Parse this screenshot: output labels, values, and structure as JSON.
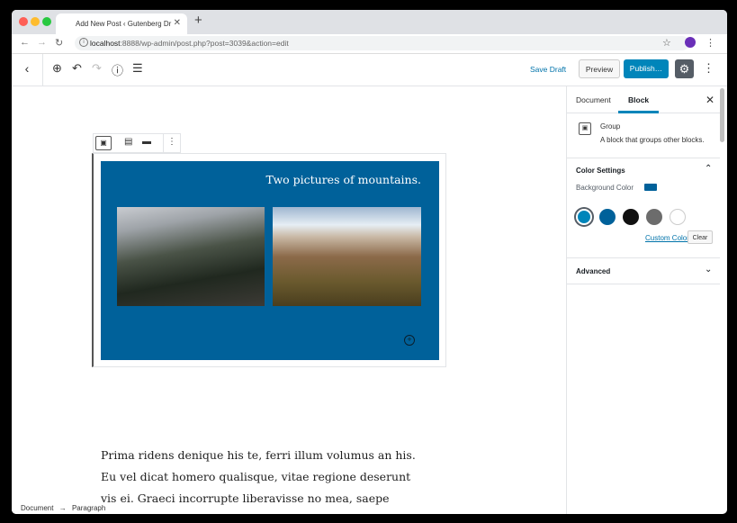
{
  "browser": {
    "tab_title": "Add New Post ‹ Gutenberg Dr",
    "tab_close": "✕",
    "new_tab": "+",
    "url_host": "localhost",
    "url_rest": ":8888/wp-admin/post.php?post=3039&action=edit",
    "traffic_lights": [
      "#fe5f57",
      "#febc2e",
      "#28c840"
    ]
  },
  "editor_toolbar": {
    "save_draft": "Save Draft",
    "preview": "Preview",
    "publish": "Publish…"
  },
  "content": {
    "group_title": "Two pictures of mountains.",
    "group_color": "#00619a",
    "paragraph": "Prima ridens denique his te, ferri illum volumus an his. Eu vel dicat homero qualisque, vitae regione deserunt vis ei. Graeci incorrupte liberavisse no mea, saepe voluptaria usu ex, vis dicant"
  },
  "breadcrumb": {
    "root": "Document",
    "arrow": "→",
    "current": "Paragraph"
  },
  "sidebar": {
    "tabs": [
      {
        "label": "Document",
        "active": false
      },
      {
        "label": "Block",
        "active": true
      }
    ],
    "close": "✕",
    "block_card": {
      "name": "Group",
      "description": "A block that groups other blocks."
    },
    "color_settings": {
      "title": "Color Settings",
      "background_label": "Background Color",
      "swatches": [
        "#0085ba",
        "#00619a",
        "#111111",
        "#6c6c6c",
        "#ffffff"
      ],
      "custom_color": "Custom Color",
      "clear": "Clear"
    },
    "advanced": {
      "title": "Advanced"
    }
  }
}
